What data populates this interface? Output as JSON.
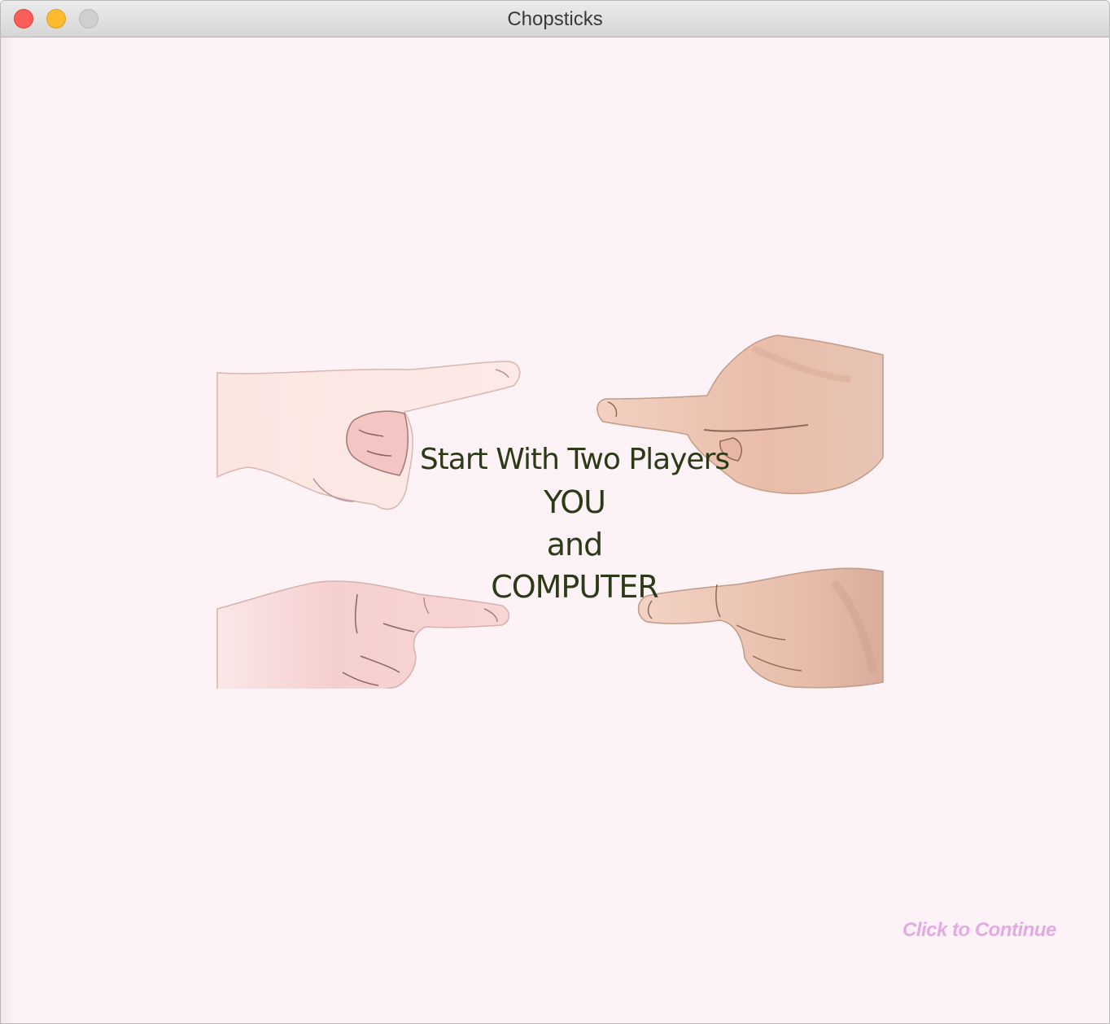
{
  "window": {
    "title": "Chopsticks"
  },
  "intro": {
    "line1": "Start With Two Players",
    "line2": "YOU",
    "line3": "and",
    "line4": "COMPUTER"
  },
  "continue_label": "Click to Continue",
  "colors": {
    "background": "#fdf3f7",
    "message_text": "#2c3a18",
    "continue_text": "#e3a9e2",
    "hand_you": "#f7d8d8",
    "hand_computer": "#ecc3b0"
  }
}
